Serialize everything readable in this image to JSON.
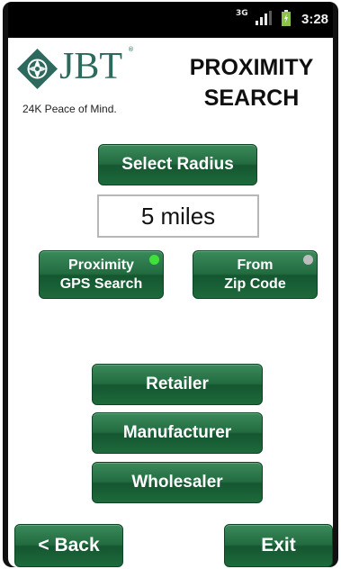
{
  "status_bar": {
    "network": "3G",
    "time": "3:28",
    "icons": [
      "3g-icon",
      "signal-icon",
      "battery-icon"
    ]
  },
  "header": {
    "logo_text": "JBT",
    "logo_registered": "®",
    "tagline": "24K Peace of Mind.",
    "title_line1": "PROXIMITY",
    "title_line2": "SEARCH"
  },
  "radius": {
    "button_label": "Select Radius",
    "value": "5 miles"
  },
  "search_mode": {
    "gps": {
      "line1": "Proximity",
      "line2": "GPS Search",
      "selected": true,
      "indicator_color": "#3fe03a"
    },
    "zip": {
      "line1": "From",
      "line2": "Zip Code",
      "selected": false,
      "indicator_color": "#bdbdbd"
    }
  },
  "categories": {
    "retailer": "Retailer",
    "manufacturer": "Manufacturer",
    "wholesaler": "Wholesaler"
  },
  "footer": {
    "back_label": "< Back",
    "exit_label": "Exit"
  },
  "colors": {
    "brand_green": "#2d6a5d",
    "button_green": "#226b40"
  }
}
